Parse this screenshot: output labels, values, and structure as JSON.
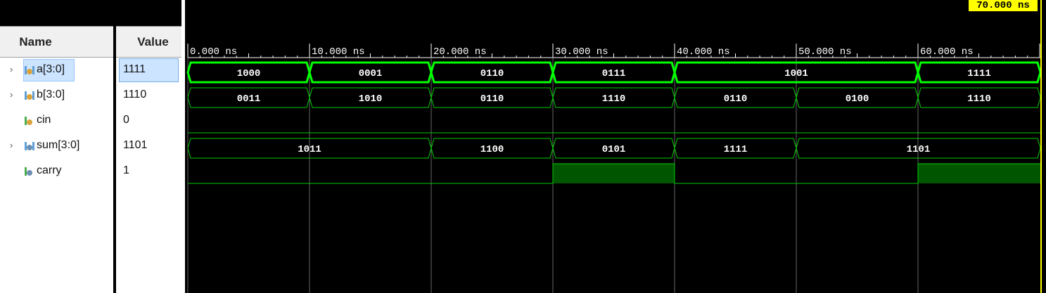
{
  "columns": {
    "name": "Name",
    "value": "Value"
  },
  "cursor_time": "70.000 ns",
  "time_ticks": [
    "0.000 ns",
    "10.000 ns",
    "20.000 ns",
    "30.000 ns",
    "40.000 ns",
    "50.000 ns",
    "60.000 ns"
  ],
  "signals": [
    {
      "name": "a[3:0]",
      "value": "1111",
      "bus": true,
      "icon": "bus-input-icon",
      "selected": true,
      "segments": [
        [
          "1000",
          0,
          10
        ],
        [
          "0001",
          10,
          20
        ],
        [
          "0110",
          20,
          30
        ],
        [
          "0111",
          30,
          40
        ],
        [
          "1001",
          40,
          60
        ],
        [
          "1111",
          60,
          70
        ]
      ]
    },
    {
      "name": "b[3:0]",
      "value": "1110",
      "bus": true,
      "icon": "bus-input-icon",
      "selected": false,
      "segments": [
        [
          "0011",
          0,
          10
        ],
        [
          "1010",
          10,
          20
        ],
        [
          "0110",
          20,
          30
        ],
        [
          "1110",
          30,
          40
        ],
        [
          "0110",
          40,
          50
        ],
        [
          "0100",
          50,
          60
        ],
        [
          "1110",
          60,
          70
        ]
      ]
    },
    {
      "name": "cin",
      "value": "0",
      "bus": false,
      "icon": "bit-input-icon",
      "selected": false,
      "levels": [
        [
          0,
          0,
          70
        ]
      ]
    },
    {
      "name": "sum[3:0]",
      "value": "1101",
      "bus": true,
      "icon": "bus-output-icon",
      "selected": false,
      "segments": [
        [
          "1011",
          0,
          20
        ],
        [
          "1100",
          20,
          30
        ],
        [
          "0101",
          30,
          40
        ],
        [
          "1111",
          40,
          50
        ],
        [
          "1101",
          50,
          70
        ]
      ]
    },
    {
      "name": "carry",
      "value": "1",
      "bus": false,
      "icon": "bit-output-icon",
      "selected": false,
      "levels": [
        [
          0,
          0,
          30
        ],
        [
          1,
          30,
          40
        ],
        [
          0,
          40,
          60
        ],
        [
          1,
          60,
          70
        ]
      ]
    }
  ],
  "colors": {
    "wave": "#00ff00",
    "wave_dim": "#00cc00",
    "high_fill": "#005500",
    "cursor": "#ffff00",
    "grid": "#444444"
  }
}
